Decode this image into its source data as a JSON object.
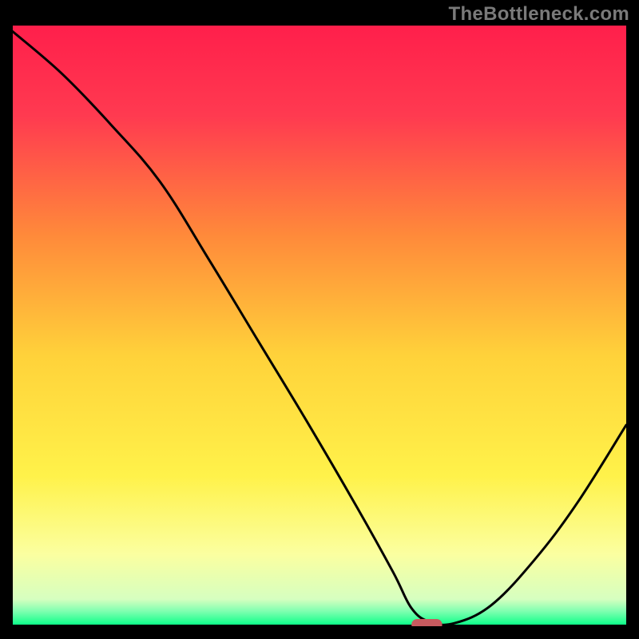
{
  "chart_data": {
    "type": "line",
    "watermark": "TheBottleneck.com",
    "xlim": [
      0,
      100
    ],
    "ylim": [
      0,
      100
    ],
    "x": [
      0,
      8,
      16,
      24,
      32,
      40,
      48,
      56,
      62,
      65,
      68,
      72,
      78,
      85,
      92,
      100
    ],
    "values": [
      99,
      92,
      83.5,
      74,
      61,
      47.5,
      34,
      20,
      9,
      3,
      0.7,
      0.5,
      3.5,
      11,
      20.5,
      33.5
    ],
    "smooth": true,
    "marker": {
      "x_start": 65,
      "x_end": 70,
      "y": 0,
      "color": "#c85a5f"
    },
    "colors": {
      "gradient_top": "#ff1f4b",
      "gradient_mid": "#ffd23a",
      "gradient_bottom": "#00ff85",
      "curve": "#000000",
      "frame": "#000000"
    },
    "title": "",
    "xlabel": "",
    "ylabel": ""
  }
}
